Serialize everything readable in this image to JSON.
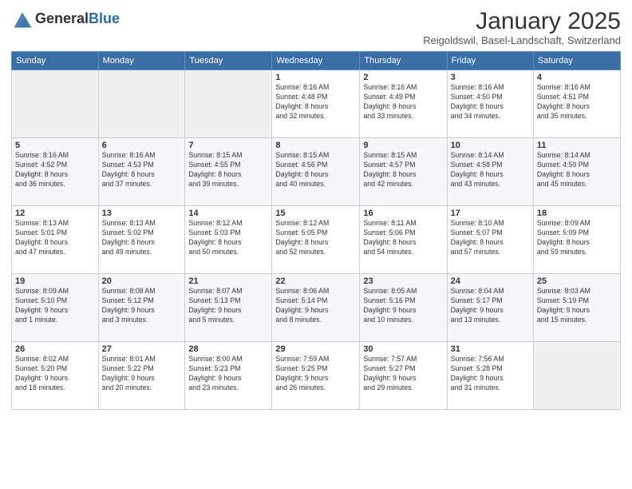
{
  "header": {
    "logo_general": "General",
    "logo_blue": "Blue",
    "month": "January 2025",
    "location": "Reigoldswil, Basel-Landschaft, Switzerland"
  },
  "days_of_week": [
    "Sunday",
    "Monday",
    "Tuesday",
    "Wednesday",
    "Thursday",
    "Friday",
    "Saturday"
  ],
  "weeks": [
    [
      {
        "day": "",
        "info": ""
      },
      {
        "day": "",
        "info": ""
      },
      {
        "day": "",
        "info": ""
      },
      {
        "day": "1",
        "info": "Sunrise: 8:16 AM\nSunset: 4:48 PM\nDaylight: 8 hours\nand 32 minutes."
      },
      {
        "day": "2",
        "info": "Sunrise: 8:16 AM\nSunset: 4:49 PM\nDaylight: 8 hours\nand 33 minutes."
      },
      {
        "day": "3",
        "info": "Sunrise: 8:16 AM\nSunset: 4:50 PM\nDaylight: 8 hours\nand 34 minutes."
      },
      {
        "day": "4",
        "info": "Sunrise: 8:16 AM\nSunset: 4:51 PM\nDaylight: 8 hours\nand 35 minutes."
      }
    ],
    [
      {
        "day": "5",
        "info": "Sunrise: 8:16 AM\nSunset: 4:52 PM\nDaylight: 8 hours\nand 36 minutes."
      },
      {
        "day": "6",
        "info": "Sunrise: 8:16 AM\nSunset: 4:53 PM\nDaylight: 8 hours\nand 37 minutes."
      },
      {
        "day": "7",
        "info": "Sunrise: 8:15 AM\nSunset: 4:55 PM\nDaylight: 8 hours\nand 39 minutes."
      },
      {
        "day": "8",
        "info": "Sunrise: 8:15 AM\nSunset: 4:56 PM\nDaylight: 8 hours\nand 40 minutes."
      },
      {
        "day": "9",
        "info": "Sunrise: 8:15 AM\nSunset: 4:57 PM\nDaylight: 8 hours\nand 42 minutes."
      },
      {
        "day": "10",
        "info": "Sunrise: 8:14 AM\nSunset: 4:58 PM\nDaylight: 8 hours\nand 43 minutes."
      },
      {
        "day": "11",
        "info": "Sunrise: 8:14 AM\nSunset: 4:59 PM\nDaylight: 8 hours\nand 45 minutes."
      }
    ],
    [
      {
        "day": "12",
        "info": "Sunrise: 8:13 AM\nSunset: 5:01 PM\nDaylight: 8 hours\nand 47 minutes."
      },
      {
        "day": "13",
        "info": "Sunrise: 8:13 AM\nSunset: 5:02 PM\nDaylight: 8 hours\nand 49 minutes."
      },
      {
        "day": "14",
        "info": "Sunrise: 8:12 AM\nSunset: 5:03 PM\nDaylight: 8 hours\nand 50 minutes."
      },
      {
        "day": "15",
        "info": "Sunrise: 8:12 AM\nSunset: 5:05 PM\nDaylight: 8 hours\nand 52 minutes."
      },
      {
        "day": "16",
        "info": "Sunrise: 8:11 AM\nSunset: 5:06 PM\nDaylight: 8 hours\nand 54 minutes."
      },
      {
        "day": "17",
        "info": "Sunrise: 8:10 AM\nSunset: 5:07 PM\nDaylight: 8 hours\nand 57 minutes."
      },
      {
        "day": "18",
        "info": "Sunrise: 8:09 AM\nSunset: 5:09 PM\nDaylight: 8 hours\nand 59 minutes."
      }
    ],
    [
      {
        "day": "19",
        "info": "Sunrise: 8:09 AM\nSunset: 5:10 PM\nDaylight: 9 hours\nand 1 minute."
      },
      {
        "day": "20",
        "info": "Sunrise: 8:08 AM\nSunset: 5:12 PM\nDaylight: 9 hours\nand 3 minutes."
      },
      {
        "day": "21",
        "info": "Sunrise: 8:07 AM\nSunset: 5:13 PM\nDaylight: 9 hours\nand 5 minutes."
      },
      {
        "day": "22",
        "info": "Sunrise: 8:06 AM\nSunset: 5:14 PM\nDaylight: 9 hours\nand 8 minutes."
      },
      {
        "day": "23",
        "info": "Sunrise: 8:05 AM\nSunset: 5:16 PM\nDaylight: 9 hours\nand 10 minutes."
      },
      {
        "day": "24",
        "info": "Sunrise: 8:04 AM\nSunset: 5:17 PM\nDaylight: 9 hours\nand 13 minutes."
      },
      {
        "day": "25",
        "info": "Sunrise: 8:03 AM\nSunset: 5:19 PM\nDaylight: 9 hours\nand 15 minutes."
      }
    ],
    [
      {
        "day": "26",
        "info": "Sunrise: 8:02 AM\nSunset: 5:20 PM\nDaylight: 9 hours\nand 18 minutes."
      },
      {
        "day": "27",
        "info": "Sunrise: 8:01 AM\nSunset: 5:22 PM\nDaylight: 9 hours\nand 20 minutes."
      },
      {
        "day": "28",
        "info": "Sunrise: 8:00 AM\nSunset: 5:23 PM\nDaylight: 9 hours\nand 23 minutes."
      },
      {
        "day": "29",
        "info": "Sunrise: 7:59 AM\nSunset: 5:25 PM\nDaylight: 9 hours\nand 26 minutes."
      },
      {
        "day": "30",
        "info": "Sunrise: 7:57 AM\nSunset: 5:27 PM\nDaylight: 9 hours\nand 29 minutes."
      },
      {
        "day": "31",
        "info": "Sunrise: 7:56 AM\nSunset: 5:28 PM\nDaylight: 9 hours\nand 31 minutes."
      },
      {
        "day": "",
        "info": ""
      }
    ]
  ]
}
